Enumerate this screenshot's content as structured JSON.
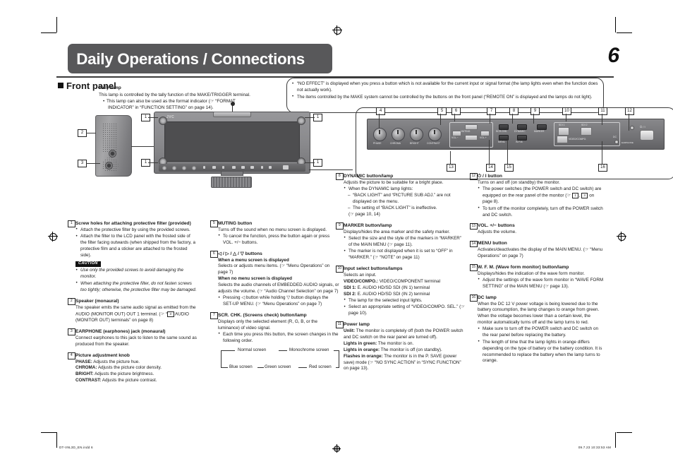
{
  "header": {
    "title": "Daily Operations / Connections",
    "page_number": "6",
    "section": "Front panel"
  },
  "tally": {
    "heading": "Tally lamp",
    "line1": "This lamp is controlled by the tally function of the MAKE/TRIGGER terminal.",
    "bullet1": "This lamp can also be used as the format indicator (☞ “FORMAT",
    "bullet1b": "INDICATOR” in “FUNCTION SETTING” on page 14)."
  },
  "notebox": {
    "note1": "“NO EFFECT” is displayed when you press a button which is not available for the current input or signal format (the lamp lights even when the function does not actually work).",
    "note2": "The items controlled by the MAKE system cannot be controlled by the buttons on the front panel (“REMOTE ON” is displayed and the lamps do not light)."
  },
  "diagram": {
    "jvc_logo": "JVC",
    "callouts": [
      "1",
      "1",
      "1",
      "1",
      "2",
      "3",
      "4",
      "5",
      "6",
      "7",
      "8",
      "9",
      "10",
      "11",
      "12",
      "13",
      "14",
      "15",
      "16"
    ],
    "panel_labels": {
      "phase": "PHASE",
      "chroma": "CHROMA",
      "bright": "BRIGHT",
      "contrast": "CONTRAST",
      "scr_chk": "SCR.CHK.",
      "dynamic": "DYNAMIC",
      "marker": "MARKER",
      "menu": "MENU",
      "wfm": "W.F.M.",
      "sdi1": "SDI 1",
      "sdi2": "SDI 2",
      "video_compo": "VIDEO/COMPO.",
      "vol_minus": "VOL.−",
      "vol_plus": "VOL.+",
      "muting": "MUTING",
      "power": "⏻ / I",
      "dc": "DC",
      "earphone": "EARPHONE"
    }
  },
  "items": [
    {
      "num": "1",
      "title": "Screw holes for attaching protective filter (provided)",
      "bullets": [
        "Attach the protective filter by using the provided screws.",
        "Attach the filter to the LCD panel with the frosted side of the filter facing outwards (when shipped from the factory, a protective film and a sticker are attached to the frosted side)."
      ],
      "caution_tag": "CAUTION",
      "caution_bullets": [
        "Use only the provided screws to avoid damaging the monitor.",
        "When attaching the protective filter, do not fasten screws too tightly; otherwise, the protective filter may be damaged."
      ]
    },
    {
      "num": "2",
      "title": "Speaker (monaural)",
      "text": "The speaker emits the same audio signal as emitted from the AUDIO (MONITOR OUT) OUT 1 terminal. (☞ “",
      "text_sq": "3",
      "text2": " AUDIO (MONITOR OUT) terminals” on page 8)"
    },
    {
      "num": "3",
      "title": "EARPHONE (earphones) jack (monaural)",
      "text": "Connect earphones to this jack to listen to the same sound as produced from the speaker."
    },
    {
      "num": "4",
      "title": "Picture adjustment knob",
      "defs": [
        {
          "term": "PHASE:",
          "desc": " Adjusts the picture hue."
        },
        {
          "term": "CHROMA:",
          "desc": " Adjusts the picture color density."
        },
        {
          "term": "BRIGHT:",
          "desc": " Adjusts the picture brightness."
        },
        {
          "term": "CONTRAST:",
          "desc": " Adjusts the picture contrast."
        }
      ]
    },
    {
      "num": "5",
      "title": "MUTING button",
      "text": "Turns off the sound when no menu screen is displayed.",
      "bullets": [
        "To cancel the function, press the button again or press VOL. +/− buttons."
      ]
    },
    {
      "num": "6",
      "title": "◁ / ▷ / △ / ▽ buttons",
      "sub1": "When a menu screen is displayed",
      "sub1_text": "Selects or adjusts menu items. (☞ “Menu Operations” on page 7)",
      "sub2": "When no menu screen is displayed",
      "sub2_text": "Selects the audio channels of EMBEDDED AUDIO signals, or adjusts the volume. (☞ “Audio Channel Selection” on page 7)",
      "bullets": [
        "Pressing ◁ button while holding ▽ button displays the SET-UP MENU. (☞ “Menu Operations” on page 7)"
      ]
    },
    {
      "num": "7",
      "title": "SCR. CHK. (Screens check) button/lamp",
      "text": "Displays only the selected element (R, G, B, or the luminance) of video signal.",
      "bullets": [
        "Each time you press this button, the screen changes in the following order."
      ],
      "order": {
        "normal": "Normal screen",
        "mono": "Monochrome screen",
        "red": "Red screen",
        "green": "Green screen",
        "blue": "Blue screen"
      }
    },
    {
      "num": "8",
      "title": "DYNAMIC button/lamp",
      "text": "Adjusts the picture to be suitable for a bright place.",
      "bullets": [
        "When the DYNAMIC lamp lights:"
      ],
      "dashes": [
        "“BACK LIGHT” and “PICTURE SUB ADJ.” are not displayed on the menu.",
        "The setting of “BACK LIGHT” is ineffective."
      ],
      "tail": "(☞ page 10, 14)"
    },
    {
      "num": "9",
      "title": "MARKER button/lamp",
      "text": "Displays/hides the area marker and the safety marker.",
      "bullets": [
        "Select the size and the style of the markers in “MARKER” of the MAIN MENU (☞ page 11).",
        "The marker is not displayed when it is set to “OFF” in “MARKER.” (☞ “NOTE” on page 11)"
      ]
    },
    {
      "num": "10",
      "title": "Input select buttons/lamps",
      "text": "Selects an input.",
      "defs": [
        {
          "term": "VIDEO/COMPO.:",
          "desc": " VIDEO/COMPONENT terminal"
        },
        {
          "term": "SDI 1:",
          "desc": " E. AUDIO HD/SD SDI (IN 1) terminal"
        },
        {
          "term": "SDI 2:",
          "desc": " E. AUDIO HD/SD SDI (IN 2) terminal"
        }
      ],
      "bullets": [
        "The lamp for the selected input lights.",
        "Select an appropriate setting of “VIDEO/COMPO. SEL.” (☞ page 10)."
      ]
    },
    {
      "num": "11",
      "title": "Power lamp",
      "defs": [
        {
          "term": "Unlit:",
          "desc": " The monitor is completely off (both the POWER switch and DC switch on the rear panel are turned off)."
        },
        {
          "term": "Lights in green:",
          "desc": " The monitor is on."
        },
        {
          "term": "Lights in orange:",
          "desc": " The monitor is off (on standby)."
        },
        {
          "term": "Flashes in orange:",
          "desc": " The monitor is in the P. SAVE (power save) mode (☞ “NO SYNC ACTION” in “SYNC FUNCTION” on page 13)."
        }
      ]
    },
    {
      "num": "12",
      "title": "⏻ / I button",
      "text": "Turns on and off (on standby) the monitor.",
      "bullets_rich": [
        {
          "pre": "The power switches (the POWER switch and DC switch) are equipped on the rear panel of the monitor (☞ ",
          "sq1": "1",
          "mid": ", ",
          "sq2": "3",
          "post": " on page 8)."
        },
        {
          "pre": "To turn off the monitor completely, turn off the POWER switch and DC switch.",
          "sq1": "",
          "mid": "",
          "sq2": "",
          "post": ""
        }
      ]
    },
    {
      "num": "13",
      "title": "VOL. +/− buttons",
      "text": "Adjusts the volume."
    },
    {
      "num": "14",
      "title": "MENU button",
      "text": "Activates/deactivates the display of the MAIN MENU. (☞ “Menu Operations” on page 7)"
    },
    {
      "num": "15",
      "title": "W. F. M. (Wave form monitor) button/lamp",
      "text": "Displays/hides the indication of the wave form monitor.",
      "bullets": [
        "Adjust the settings of the wave form monitor in “WAVE FORM SETTING” of the MAIN MENU (☞ page 13)."
      ]
    },
    {
      "num": "16",
      "title": "DC lamp",
      "text": "When the DC 12 V power voltage is being lowered due to the battery consumption, the lamp changes to orange from green. When the voltage becomes lower than a certain level, the monitor automatically turns off and the lamp turns to red.",
      "bullets": [
        "Make sure to turn off the POWER switch and DC switch on the rear panel before replacing the battery.",
        "The length of time that the lamp lights in orange differs depending on the type of battery or the battery condition. It is recommended to replace the battery when the lamp turns to orange."
      ]
    }
  ],
  "footer": {
    "left": "DT-V9L3D_EN.indd   6",
    "right": "09.7.23   10:33:53 AM"
  }
}
